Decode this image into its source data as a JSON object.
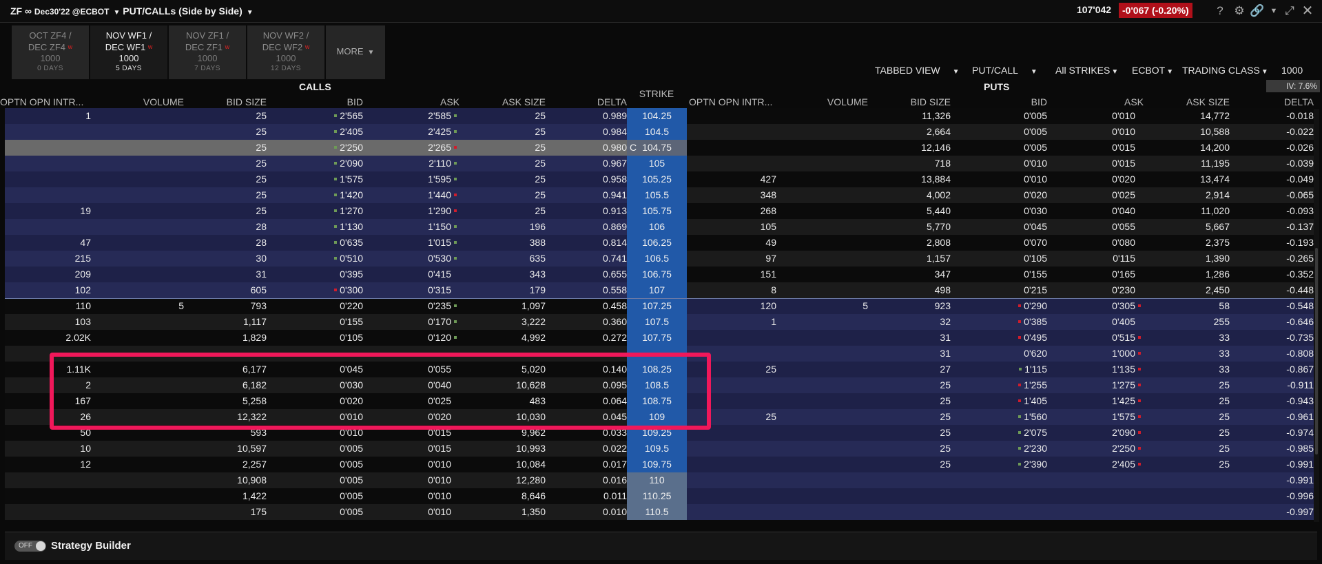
{
  "title": {
    "symbol": "ZF",
    "symbol_sep": "∞",
    "contract": "Dec30'22 @ECBOT",
    "view": "PUT/CALLs (Side by Side)",
    "last_price": "107'042",
    "change": "-0'067 (-0.20%)"
  },
  "toolbar_icons": [
    "help-icon",
    "gear-icon",
    "link-icon",
    "chevron-down-icon",
    "expand-icon",
    "close-icon"
  ],
  "tabs": [
    {
      "line1": "OCT ZF4 /",
      "line2": "DEC ZF4",
      "multiplier": "1000",
      "days": "0 DAYS",
      "active": false
    },
    {
      "line1": "NOV WF1 /",
      "line2": "DEC WF1",
      "multiplier": "1000",
      "days": "5 DAYS",
      "active": true
    },
    {
      "line1": "NOV ZF1 /",
      "line2": "DEC ZF1",
      "multiplier": "1000",
      "days": "7 DAYS",
      "active": false
    },
    {
      "line1": "NOV WF2 /",
      "line2": "DEC WF2",
      "multiplier": "1000",
      "days": "12 DAYS",
      "active": false
    }
  ],
  "more_tab": "MORE",
  "options_bar": {
    "tabbed_view": "TABBED VIEW",
    "put_call": "PUT/CALL",
    "strikes": "All STRIKES",
    "exchange": "ECBOT",
    "trading_class": "TRADING CLASS",
    "multiplier": "1000"
  },
  "iv": "IV: 7.6%",
  "calls_title": "CALLS",
  "puts_title": "PUTS",
  "strike_header": "STRIKE",
  "calls_columns": [
    "OPTN OPN INTR...",
    "VOLUME",
    "BID SIZE",
    "BID",
    "ASK",
    "ASK SIZE",
    "DELTA"
  ],
  "puts_columns": [
    "OPTN OPN INTR...",
    "VOLUME",
    "BID SIZE",
    "BID",
    "ASK",
    "ASK SIZE",
    "DELTA"
  ],
  "rows": [
    {
      "c_oi": "1",
      "c_vol": "",
      "c_bs": "25",
      "c_bid": "2'565",
      "c_bid_m": "g",
      "c_ask": "2'585",
      "c_ask_m": "g",
      "c_as": "25",
      "c_delta": "0.989",
      "strike": "104.25",
      "p_oi": "",
      "p_vol": "",
      "p_bs": "11,326",
      "p_bid": "0'005",
      "p_bid_m": "",
      "p_ask": "0'010",
      "p_ask_m": "",
      "p_as": "14,772",
      "p_delta": "-0.018",
      "selected": false,
      "itm": false
    },
    {
      "c_oi": "",
      "c_vol": "",
      "c_bs": "25",
      "c_bid": "2'405",
      "c_bid_m": "g",
      "c_ask": "2'425",
      "c_ask_m": "g",
      "c_as": "25",
      "c_delta": "0.984",
      "strike": "104.5",
      "p_oi": "",
      "p_vol": "",
      "p_bs": "2,664",
      "p_bid": "0'005",
      "p_bid_m": "",
      "p_ask": "0'010",
      "p_ask_m": "",
      "p_as": "10,588",
      "p_delta": "-0.022",
      "selected": false,
      "itm": false
    },
    {
      "c_oi": "",
      "c_vol": "",
      "c_bs": "25",
      "c_bid": "2'250",
      "c_bid_m": "g",
      "c_ask": "2'265",
      "c_ask_m": "r",
      "c_as": "25",
      "c_delta": "0.980",
      "strike": "104.75",
      "strike_prefix": "C",
      "p_oi": "",
      "p_vol": "",
      "p_bs": "12,146",
      "p_bid": "0'005",
      "p_bid_m": "",
      "p_ask": "0'015",
      "p_ask_m": "",
      "p_as": "14,200",
      "p_delta": "-0.026",
      "selected": true,
      "itm": false
    },
    {
      "c_oi": "",
      "c_vol": "",
      "c_bs": "25",
      "c_bid": "2'090",
      "c_bid_m": "g",
      "c_ask": "2'110",
      "c_ask_m": "g",
      "c_as": "25",
      "c_delta": "0.967",
      "strike": "105",
      "p_oi": "",
      "p_vol": "",
      "p_bs": "718",
      "p_bid": "0'010",
      "p_bid_m": "",
      "p_ask": "0'015",
      "p_ask_m": "",
      "p_as": "11,195",
      "p_delta": "-0.039",
      "selected": false,
      "itm": false
    },
    {
      "c_oi": "",
      "c_vol": "",
      "c_bs": "25",
      "c_bid": "1'575",
      "c_bid_m": "g",
      "c_ask": "1'595",
      "c_ask_m": "g",
      "c_as": "25",
      "c_delta": "0.958",
      "strike": "105.25",
      "p_oi": "427",
      "p_vol": "",
      "p_bs": "13,884",
      "p_bid": "0'010",
      "p_bid_m": "",
      "p_ask": "0'020",
      "p_ask_m": "",
      "p_as": "13,474",
      "p_delta": "-0.049",
      "selected": false,
      "itm": false
    },
    {
      "c_oi": "",
      "c_vol": "",
      "c_bs": "25",
      "c_bid": "1'420",
      "c_bid_m": "g",
      "c_ask": "1'440",
      "c_ask_m": "r",
      "c_as": "25",
      "c_delta": "0.941",
      "strike": "105.5",
      "p_oi": "348",
      "p_vol": "",
      "p_bs": "4,002",
      "p_bid": "0'020",
      "p_bid_m": "",
      "p_ask": "0'025",
      "p_ask_m": "",
      "p_as": "2,914",
      "p_delta": "-0.065",
      "selected": false,
      "itm": false
    },
    {
      "c_oi": "19",
      "c_vol": "",
      "c_bs": "25",
      "c_bid": "1'270",
      "c_bid_m": "g",
      "c_ask": "1'290",
      "c_ask_m": "r",
      "c_as": "25",
      "c_delta": "0.913",
      "strike": "105.75",
      "p_oi": "268",
      "p_vol": "",
      "p_bs": "5,440",
      "p_bid": "0'030",
      "p_bid_m": "",
      "p_ask": "0'040",
      "p_ask_m": "",
      "p_as": "11,020",
      "p_delta": "-0.093",
      "selected": false,
      "itm": false
    },
    {
      "c_oi": "",
      "c_vol": "",
      "c_bs": "28",
      "c_bid": "1'130",
      "c_bid_m": "g",
      "c_ask": "1'150",
      "c_ask_m": "g",
      "c_as": "196",
      "c_delta": "0.869",
      "strike": "106",
      "p_oi": "105",
      "p_vol": "",
      "p_bs": "5,770",
      "p_bid": "0'045",
      "p_bid_m": "",
      "p_ask": "0'055",
      "p_ask_m": "",
      "p_as": "5,667",
      "p_delta": "-0.137",
      "selected": false,
      "itm": false
    },
    {
      "c_oi": "47",
      "c_vol": "",
      "c_bs": "28",
      "c_bid": "0'635",
      "c_bid_m": "g",
      "c_ask": "1'015",
      "c_ask_m": "g",
      "c_as": "388",
      "c_delta": "0.814",
      "strike": "106.25",
      "p_oi": "49",
      "p_vol": "",
      "p_bs": "2,808",
      "p_bid": "0'070",
      "p_bid_m": "",
      "p_ask": "0'080",
      "p_ask_m": "",
      "p_as": "2,375",
      "p_delta": "-0.193",
      "selected": false,
      "itm": false
    },
    {
      "c_oi": "215",
      "c_vol": "",
      "c_bs": "30",
      "c_bid": "0'510",
      "c_bid_m": "g",
      "c_ask": "0'530",
      "c_ask_m": "g",
      "c_as": "635",
      "c_delta": "0.741",
      "strike": "106.5",
      "p_oi": "97",
      "p_vol": "",
      "p_bs": "1,157",
      "p_bid": "0'105",
      "p_bid_m": "",
      "p_ask": "0'115",
      "p_ask_m": "",
      "p_as": "1,390",
      "p_delta": "-0.265",
      "selected": false,
      "itm": false
    },
    {
      "c_oi": "209",
      "c_vol": "",
      "c_bs": "31",
      "c_bid": "0'395",
      "c_bid_m": "",
      "c_ask": "0'415",
      "c_ask_m": "",
      "c_as": "343",
      "c_delta": "0.655",
      "strike": "106.75",
      "p_oi": "151",
      "p_vol": "",
      "p_bs": "347",
      "p_bid": "0'155",
      "p_bid_m": "",
      "p_ask": "0'165",
      "p_ask_m": "",
      "p_as": "1,286",
      "p_delta": "-0.352",
      "selected": false,
      "itm": false
    },
    {
      "c_oi": "102",
      "c_vol": "",
      "c_bs": "605",
      "c_bid": "0'300",
      "c_bid_m": "r",
      "c_ask": "0'315",
      "c_ask_m": "",
      "c_as": "179",
      "c_delta": "0.558",
      "strike": "107",
      "p_oi": "8",
      "p_vol": "",
      "p_bs": "498",
      "p_bid": "0'215",
      "p_bid_m": "",
      "p_ask": "0'230",
      "p_ask_m": "",
      "p_as": "2,450",
      "p_delta": "-0.448",
      "selected": false,
      "itm": false
    },
    {
      "c_oi": "110",
      "c_vol": "5",
      "c_bs": "793",
      "c_bid": "0'220",
      "c_bid_m": "",
      "c_ask": "0'235",
      "c_ask_m": "g",
      "c_as": "1,097",
      "c_delta": "0.458",
      "strike": "107.25",
      "p_oi": "120",
      "p_vol": "5",
      "p_bs": "923",
      "p_bid": "0'290",
      "p_bid_m": "r",
      "p_ask": "0'305",
      "p_ask_m": "r",
      "p_as": "58",
      "p_delta": "-0.548",
      "selected": false,
      "itm": false
    },
    {
      "c_oi": "103",
      "c_vol": "",
      "c_bs": "1,117",
      "c_bid": "0'155",
      "c_bid_m": "",
      "c_ask": "0'170",
      "c_ask_m": "g",
      "c_as": "3,222",
      "c_delta": "0.360",
      "strike": "107.5",
      "p_oi": "1",
      "p_vol": "",
      "p_bs": "32",
      "p_bid": "0'385",
      "p_bid_m": "r",
      "p_ask": "0'405",
      "p_ask_m": "",
      "p_as": "255",
      "p_delta": "-0.646",
      "selected": false,
      "itm": false
    },
    {
      "c_oi": "2.02K",
      "c_vol": "",
      "c_bs": "1,829",
      "c_bid": "0'105",
      "c_bid_m": "",
      "c_ask": "0'120",
      "c_ask_m": "g",
      "c_as": "4,992",
      "c_delta": "0.272",
      "strike": "107.75",
      "p_oi": "",
      "p_vol": "",
      "p_bs": "31",
      "p_bid": "0'495",
      "p_bid_m": "r",
      "p_ask": "0'515",
      "p_ask_m": "r",
      "p_as": "33",
      "p_delta": "-0.735",
      "selected": false,
      "itm": false
    },
    {
      "c_oi": "",
      "c_vol": "",
      "c_bs": "",
      "c_bid": "",
      "c_bid_m": "",
      "c_ask": "",
      "c_ask_m": "",
      "c_as": "",
      "c_delta": "",
      "strike": "",
      "p_oi": "",
      "p_vol": "",
      "p_bs": "31",
      "p_bid": "0'620",
      "p_bid_m": "",
      "p_ask": "1'000",
      "p_ask_m": "r",
      "p_as": "33",
      "p_delta": "-0.808",
      "selected": false,
      "itm": false,
      "covered": true
    },
    {
      "c_oi": "1.11K",
      "c_vol": "",
      "c_bs": "6,177",
      "c_bid": "0'045",
      "c_bid_m": "",
      "c_ask": "0'055",
      "c_ask_m": "",
      "c_as": "5,020",
      "c_delta": "0.140",
      "strike": "108.25",
      "p_oi": "25",
      "p_vol": "",
      "p_bs": "27",
      "p_bid": "1'115",
      "p_bid_m": "g",
      "p_ask": "1'135",
      "p_ask_m": "r",
      "p_as": "33",
      "p_delta": "-0.867",
      "selected": false,
      "itm": false
    },
    {
      "c_oi": "2",
      "c_vol": "",
      "c_bs": "6,182",
      "c_bid": "0'030",
      "c_bid_m": "",
      "c_ask": "0'040",
      "c_ask_m": "",
      "c_as": "10,628",
      "c_delta": "0.095",
      "strike": "108.5",
      "p_oi": "",
      "p_vol": "",
      "p_bs": "25",
      "p_bid": "1'255",
      "p_bid_m": "r",
      "p_ask": "1'275",
      "p_ask_m": "r",
      "p_as": "25",
      "p_delta": "-0.911",
      "selected": false,
      "itm": false
    },
    {
      "c_oi": "167",
      "c_vol": "",
      "c_bs": "5,258",
      "c_bid": "0'020",
      "c_bid_m": "",
      "c_ask": "0'025",
      "c_ask_m": "",
      "c_as": "483",
      "c_delta": "0.064",
      "strike": "108.75",
      "p_oi": "",
      "p_vol": "",
      "p_bs": "25",
      "p_bid": "1'405",
      "p_bid_m": "r",
      "p_ask": "1'425",
      "p_ask_m": "r",
      "p_as": "25",
      "p_delta": "-0.943",
      "selected": false,
      "itm": false
    },
    {
      "c_oi": "26",
      "c_vol": "",
      "c_bs": "12,322",
      "c_bid": "0'010",
      "c_bid_m": "",
      "c_ask": "0'020",
      "c_ask_m": "",
      "c_as": "10,030",
      "c_delta": "0.045",
      "strike": "109",
      "p_oi": "25",
      "p_vol": "",
      "p_bs": "25",
      "p_bid": "1'560",
      "p_bid_m": "g",
      "p_ask": "1'575",
      "p_ask_m": "r",
      "p_as": "25",
      "p_delta": "-0.961",
      "selected": false,
      "itm": false
    },
    {
      "c_oi": "50",
      "c_vol": "",
      "c_bs": "593",
      "c_bid": "0'010",
      "c_bid_m": "",
      "c_ask": "0'015",
      "c_ask_m": "",
      "c_as": "9,962",
      "c_delta": "0.033",
      "strike": "109.25",
      "p_oi": "",
      "p_vol": "",
      "p_bs": "25",
      "p_bid": "2'075",
      "p_bid_m": "g",
      "p_ask": "2'090",
      "p_ask_m": "r",
      "p_as": "25",
      "p_delta": "-0.974",
      "selected": false,
      "itm": false
    },
    {
      "c_oi": "10",
      "c_vol": "",
      "c_bs": "10,597",
      "c_bid": "0'005",
      "c_bid_m": "",
      "c_ask": "0'015",
      "c_ask_m": "",
      "c_as": "10,993",
      "c_delta": "0.022",
      "strike": "109.5",
      "p_oi": "",
      "p_vol": "",
      "p_bs": "25",
      "p_bid": "2'230",
      "p_bid_m": "g",
      "p_ask": "2'250",
      "p_ask_m": "r",
      "p_as": "25",
      "p_delta": "-0.985",
      "selected": false,
      "itm": false
    },
    {
      "c_oi": "12",
      "c_vol": "",
      "c_bs": "2,257",
      "c_bid": "0'005",
      "c_bid_m": "",
      "c_ask": "0'010",
      "c_ask_m": "",
      "c_as": "10,084",
      "c_delta": "0.017",
      "strike": "109.75",
      "p_oi": "",
      "p_vol": "",
      "p_bs": "25",
      "p_bid": "2'390",
      "p_bid_m": "g",
      "p_ask": "2'405",
      "p_ask_m": "r",
      "p_as": "25",
      "p_delta": "-0.991",
      "selected": false,
      "itm": false
    },
    {
      "c_oi": "",
      "c_vol": "",
      "c_bs": "10,908",
      "c_bid": "0'005",
      "c_bid_m": "",
      "c_ask": "0'010",
      "c_ask_m": "",
      "c_as": "12,280",
      "c_delta": "0.016",
      "strike": "110",
      "p_oi": "",
      "p_vol": "",
      "p_bs": "",
      "p_bid": "",
      "p_bid_m": "",
      "p_ask": "",
      "p_ask_m": "",
      "p_as": "",
      "p_delta": "-0.991",
      "selected": false,
      "itm": true
    },
    {
      "c_oi": "",
      "c_vol": "",
      "c_bs": "1,422",
      "c_bid": "0'005",
      "c_bid_m": "",
      "c_ask": "0'010",
      "c_ask_m": "",
      "c_as": "8,646",
      "c_delta": "0.011",
      "strike": "110.25",
      "p_oi": "",
      "p_vol": "",
      "p_bs": "",
      "p_bid": "",
      "p_bid_m": "",
      "p_ask": "",
      "p_ask_m": "",
      "p_as": "",
      "p_delta": "-0.996",
      "selected": false,
      "itm": true
    },
    {
      "c_oi": "",
      "c_vol": "",
      "c_bs": "175",
      "c_bid": "0'005",
      "c_bid_m": "",
      "c_ask": "0'010",
      "c_ask_m": "",
      "c_as": "1,350",
      "c_delta": "0.010",
      "strike": "110.5",
      "p_oi": "",
      "p_vol": "",
      "p_bs": "",
      "p_bid": "",
      "p_bid_m": "",
      "p_ask": "",
      "p_ask_m": "",
      "p_as": "",
      "p_delta": "-0.997",
      "selected": false,
      "itm": true
    }
  ],
  "footer": {
    "toggle": "OFF",
    "label": "Strategy Builder"
  },
  "colors": {
    "strike_blue": "#2159a8",
    "strike_itm": "#5a6f8c",
    "row_call_itm": "#20224a",
    "row_put_itm": "#20224a",
    "change_red": "#b0101a",
    "highlight": "#f0185a"
  }
}
